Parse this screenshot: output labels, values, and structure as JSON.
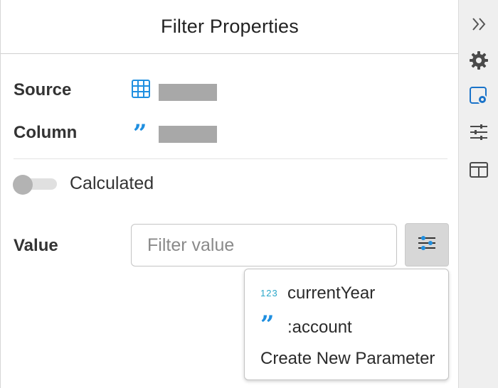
{
  "header": {
    "title": "Filter Properties"
  },
  "source": {
    "label": "Source",
    "icon": "table-grid-icon"
  },
  "column": {
    "label": "Column",
    "icon": "quote-icon"
  },
  "calculated": {
    "label": "Calculated",
    "enabled": false
  },
  "value": {
    "label": "Value",
    "input_value": "",
    "placeholder": "Filter value",
    "param_button_icon": "parameters-icon"
  },
  "dropdown": {
    "items": [
      {
        "type_badge": "123",
        "label": "currentYear"
      },
      {
        "type_badge": "”",
        "label": ":account"
      }
    ],
    "create_label": "Create New Parameter"
  },
  "sidebar": {
    "items": [
      {
        "icon": "collapse-double-chevron-icon"
      },
      {
        "icon": "gear-icon"
      },
      {
        "icon": "filter-settings-icon",
        "active": true
      },
      {
        "icon": "sliders-icon"
      },
      {
        "icon": "layout-panel-icon"
      }
    ]
  },
  "colors": {
    "accent": "#1f8fe0",
    "number_badge": "#2aa7c9",
    "active_icon": "#1a73c9"
  }
}
